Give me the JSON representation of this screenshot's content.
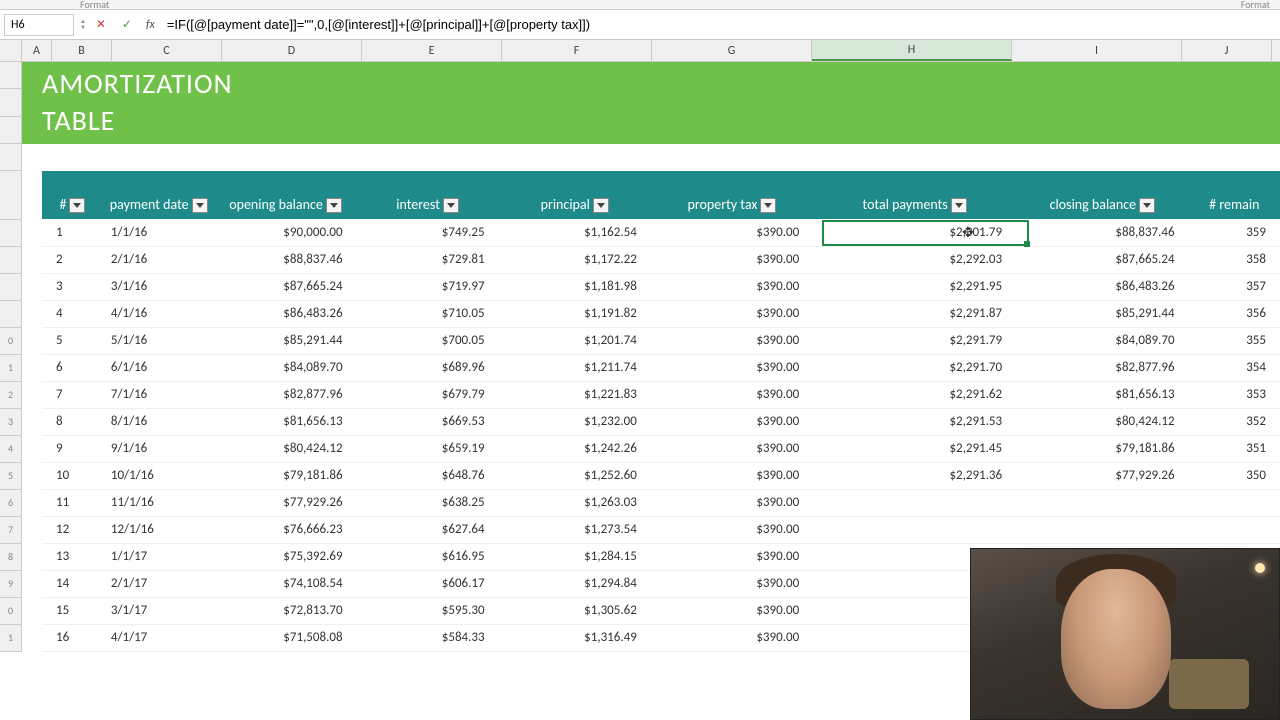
{
  "ribbon": {
    "format_label": "Format"
  },
  "formula_bar": {
    "cell_ref": "H6",
    "formula": "=IF([@[payment date]]=\"\",0,[@[interest]]+[@[principal]]+[@[property tax]])"
  },
  "columns": [
    "A",
    "B",
    "C",
    "D",
    "E",
    "F",
    "G",
    "H",
    "I",
    "J"
  ],
  "active_column": "H",
  "title": {
    "line1": "AMORTIZATION",
    "line2": "TABLE"
  },
  "headers": {
    "num": "#",
    "payment_date": "payment date",
    "opening_balance": "opening balance",
    "interest": "interest",
    "principal": "principal",
    "property_tax": "property tax",
    "total_payments": "total payments",
    "closing_balance": "closing balance",
    "remaining": "# remain"
  },
  "rows": [
    {
      "n": "1",
      "date": "1/1/16",
      "open": "$90,000.00",
      "int": "$749.25",
      "prin": "$1,162.54",
      "tax": "$390.00",
      "tot": "$2,301.79",
      "close": "$88,837.46",
      "rem": "359"
    },
    {
      "n": "2",
      "date": "2/1/16",
      "open": "$88,837.46",
      "int": "$729.81",
      "prin": "$1,172.22",
      "tax": "$390.00",
      "tot": "$2,292.03",
      "close": "$87,665.24",
      "rem": "358"
    },
    {
      "n": "3",
      "date": "3/1/16",
      "open": "$87,665.24",
      "int": "$719.97",
      "prin": "$1,181.98",
      "tax": "$390.00",
      "tot": "$2,291.95",
      "close": "$86,483.26",
      "rem": "357"
    },
    {
      "n": "4",
      "date": "4/1/16",
      "open": "$86,483.26",
      "int": "$710.05",
      "prin": "$1,191.82",
      "tax": "$390.00",
      "tot": "$2,291.87",
      "close": "$85,291.44",
      "rem": "356"
    },
    {
      "n": "5",
      "date": "5/1/16",
      "open": "$85,291.44",
      "int": "$700.05",
      "prin": "$1,201.74",
      "tax": "$390.00",
      "tot": "$2,291.79",
      "close": "$84,089.70",
      "rem": "355"
    },
    {
      "n": "6",
      "date": "6/1/16",
      "open": "$84,089.70",
      "int": "$689.96",
      "prin": "$1,211.74",
      "tax": "$390.00",
      "tot": "$2,291.70",
      "close": "$82,877.96",
      "rem": "354"
    },
    {
      "n": "7",
      "date": "7/1/16",
      "open": "$82,877.96",
      "int": "$679.79",
      "prin": "$1,221.83",
      "tax": "$390.00",
      "tot": "$2,291.62",
      "close": "$81,656.13",
      "rem": "353"
    },
    {
      "n": "8",
      "date": "8/1/16",
      "open": "$81,656.13",
      "int": "$669.53",
      "prin": "$1,232.00",
      "tax": "$390.00",
      "tot": "$2,291.53",
      "close": "$80,424.12",
      "rem": "352"
    },
    {
      "n": "9",
      "date": "9/1/16",
      "open": "$80,424.12",
      "int": "$659.19",
      "prin": "$1,242.26",
      "tax": "$390.00",
      "tot": "$2,291.45",
      "close": "$79,181.86",
      "rem": "351"
    },
    {
      "n": "10",
      "date": "10/1/16",
      "open": "$79,181.86",
      "int": "$648.76",
      "prin": "$1,252.60",
      "tax": "$390.00",
      "tot": "$2,291.36",
      "close": "$77,929.26",
      "rem": "350"
    },
    {
      "n": "11",
      "date": "11/1/16",
      "open": "$77,929.26",
      "int": "$638.25",
      "prin": "$1,263.03",
      "tax": "$390.00",
      "tot": "",
      "close": "",
      "rem": ""
    },
    {
      "n": "12",
      "date": "12/1/16",
      "open": "$76,666.23",
      "int": "$627.64",
      "prin": "$1,273.54",
      "tax": "$390.00",
      "tot": "",
      "close": "",
      "rem": ""
    },
    {
      "n": "13",
      "date": "1/1/17",
      "open": "$75,392.69",
      "int": "$616.95",
      "prin": "$1,284.15",
      "tax": "$390.00",
      "tot": "",
      "close": "",
      "rem": ""
    },
    {
      "n": "14",
      "date": "2/1/17",
      "open": "$74,108.54",
      "int": "$606.17",
      "prin": "$1,294.84",
      "tax": "$390.00",
      "tot": "",
      "close": "",
      "rem": ""
    },
    {
      "n": "15",
      "date": "3/1/17",
      "open": "$72,813.70",
      "int": "$595.30",
      "prin": "$1,305.62",
      "tax": "$390.00",
      "tot": "",
      "close": "",
      "rem": ""
    },
    {
      "n": "16",
      "date": "4/1/17",
      "open": "$71,508.08",
      "int": "$584.33",
      "prin": "$1,316.49",
      "tax": "$390.00",
      "tot": "",
      "close": "",
      "rem": ""
    }
  ],
  "row_labels": [
    "",
    "",
    "",
    "",
    "",
    "",
    "",
    "",
    "",
    "0",
    "1",
    "2",
    "3",
    "4",
    "5",
    "6",
    "7",
    "8",
    "9",
    "0",
    "1"
  ],
  "selected_cell_display": "$2,301.79"
}
